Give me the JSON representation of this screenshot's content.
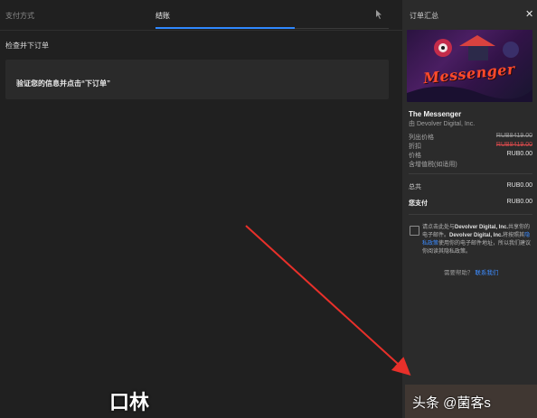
{
  "tabs": {
    "payment": "支付方式",
    "checkout": "结账"
  },
  "review": {
    "title": "检查并下订单",
    "verify_text": "验证您的信息并点击“下订单”"
  },
  "summary": {
    "header": "订单汇总",
    "cover_text": "Messenger",
    "game_title": "The Messenger",
    "publisher": "由 Devolver Digital, Inc.",
    "list_price_label": "列出价格",
    "list_price_value": "RUB8419.00",
    "discount_label": "折扣",
    "discount_value": "RUB8419.00",
    "price_label": "价格",
    "price_value": "RUB0.00",
    "tax_label": "含增值税(如适用)",
    "total_label": "总共",
    "total_value": "RUB0.00",
    "pay_label": "您支付",
    "pay_value": "RUB0.00",
    "consent_part1": "请点击此处与",
    "consent_company1": "Devolver Digital, Inc.",
    "consent_part2": "共享你的电子邮件。",
    "consent_company2": "Devolver Digital, Inc.",
    "consent_part3": "将按照其",
    "consent_link": "隐私政策",
    "consent_part4": "使用你的电子邮件地址，所以我们建议你阅读其隐私政策。",
    "help_text": "需要帮助？",
    "help_link": "联系我们"
  },
  "watermark": {
    "text": "头条 @菌客s",
    "big": "口林"
  },
  "colors": {
    "accent": "#2f88ff",
    "link": "#3d8cff",
    "discount_red": "#d4494b",
    "arrow_red": "#e8302a"
  },
  "icons": {
    "close": "close-icon",
    "cursor": "cursor-icon"
  }
}
